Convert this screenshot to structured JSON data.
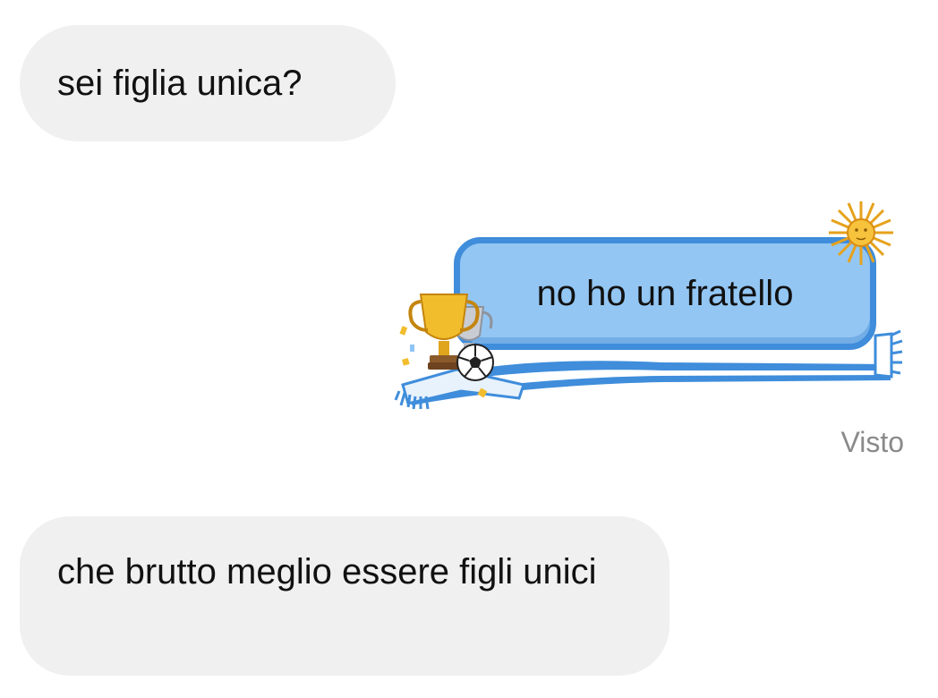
{
  "messages": [
    {
      "id": "msg1",
      "side": "received",
      "text": "sei figlia unica?"
    },
    {
      "id": "msg2",
      "side": "sent",
      "text": "no ho un fratello",
      "theme": "argentina-football"
    },
    {
      "id": "msg3",
      "side": "received",
      "text": "che brutto meglio essere figli unici"
    }
  ],
  "status": {
    "seen_label": "Visto"
  },
  "colors": {
    "received_bubble": "#f0f0f0",
    "sent_bubble_fill": "#93c6f3",
    "sent_bubble_border": "#3f8ddb",
    "seen_text": "#8a8a8a"
  },
  "icons": {
    "sun": "sun-of-may-icon",
    "trophy": "trophy-icon",
    "ball": "soccer-ball-icon",
    "scarf": "scarf-icon"
  }
}
